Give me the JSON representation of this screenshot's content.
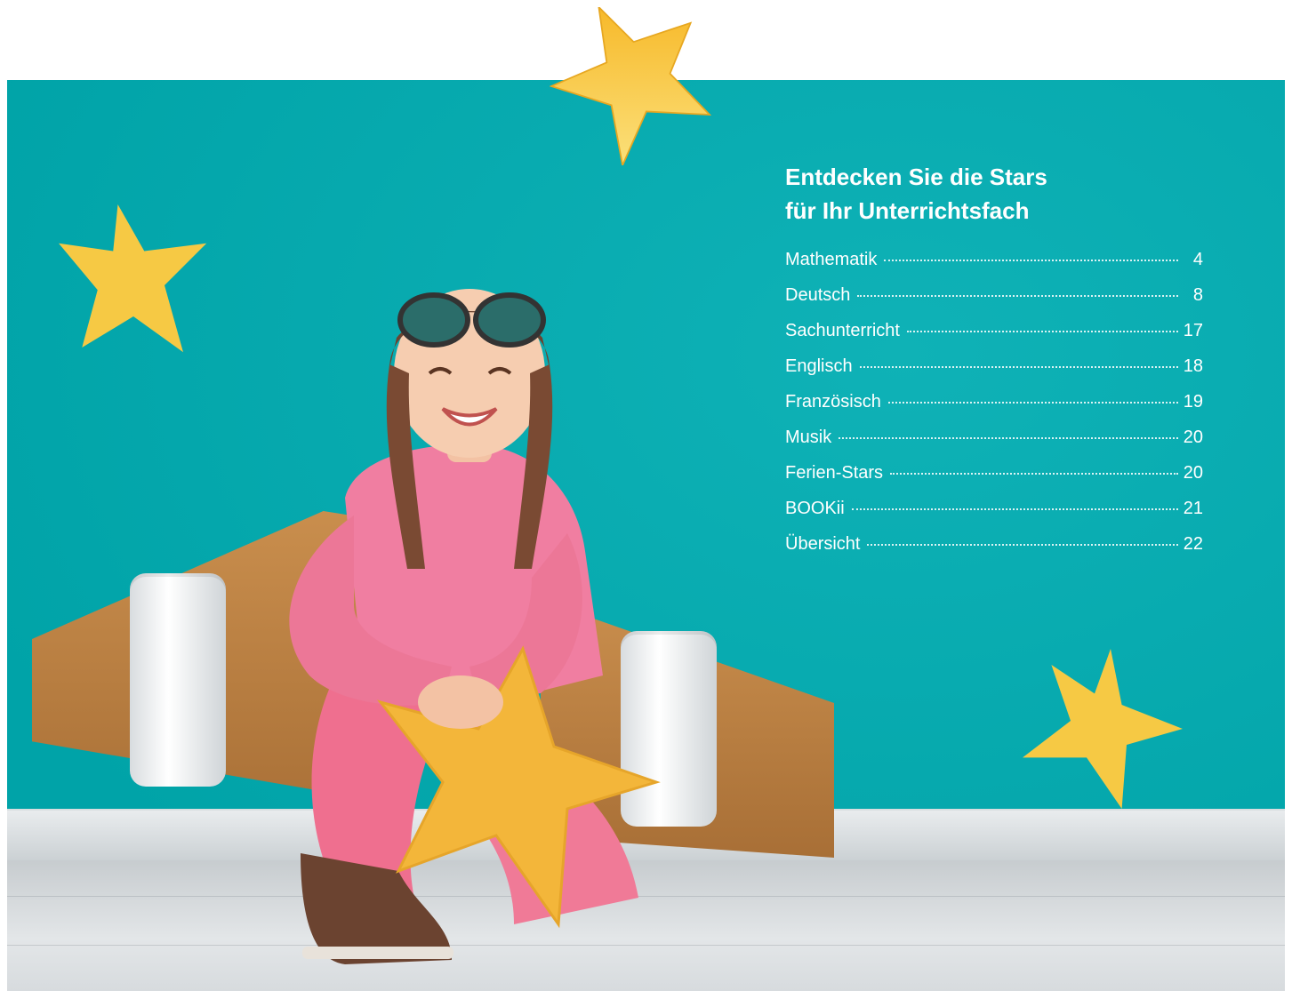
{
  "heading": {
    "line1": "Entdecken Sie die Stars",
    "line2": "für Ihr Unterrichtsfach"
  },
  "toc": [
    {
      "label": "Mathematik",
      "page": "4"
    },
    {
      "label": "Deutsch",
      "page": "8"
    },
    {
      "label": "Sachunterricht",
      "page": "17"
    },
    {
      "label": "Englisch",
      "page": "18"
    },
    {
      "label": "Französisch",
      "page": "19"
    },
    {
      "label": "Musik",
      "page": "20"
    },
    {
      "label": "Ferien-Stars",
      "page": "20"
    },
    {
      "label": "BOOKii",
      "page": "21"
    },
    {
      "label": "Übersicht",
      "page": "22"
    }
  ],
  "colors": {
    "wall": "#00adb2",
    "star": "#f6c944",
    "text": "#ffffff"
  }
}
